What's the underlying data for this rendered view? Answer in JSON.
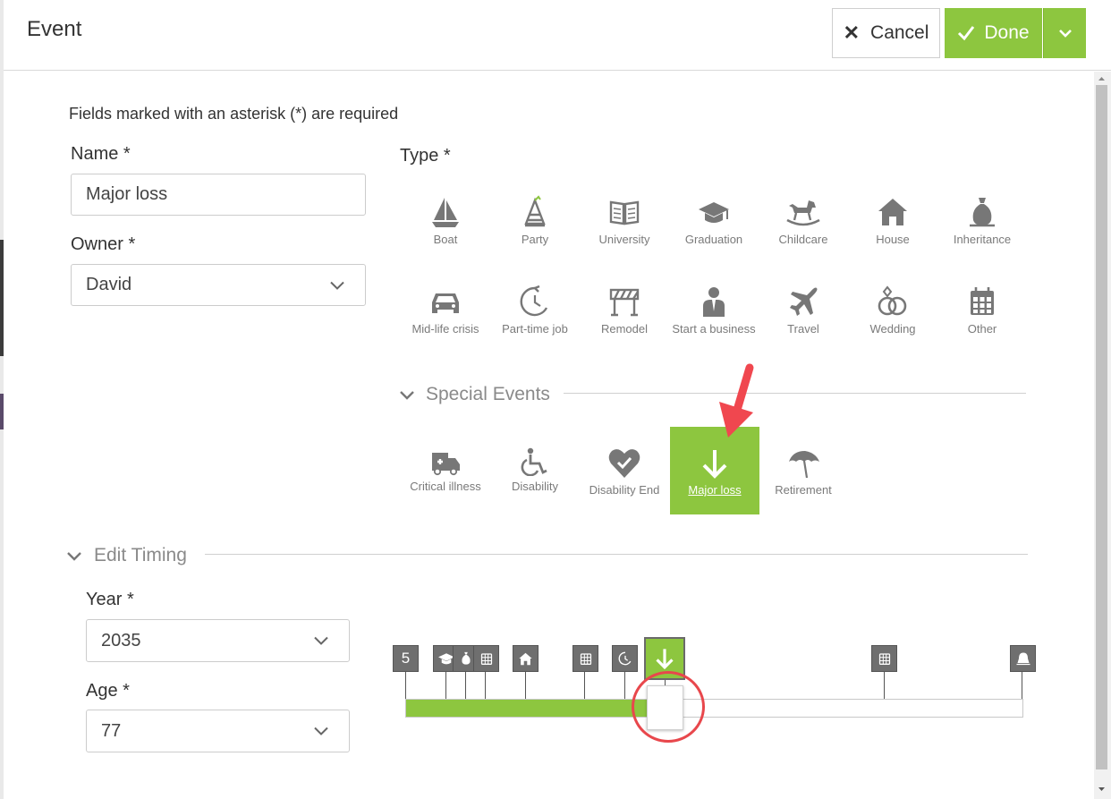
{
  "window": {
    "title": "Event"
  },
  "header": {
    "cancel_label": "Cancel",
    "done_label": "Done"
  },
  "form": {
    "required_note": "Fields marked with an asterisk (*) are required",
    "name_label": "Name *",
    "name_value": "Major loss",
    "owner_label": "Owner *",
    "owner_value": "David",
    "type_label": "Type *"
  },
  "types": [
    {
      "label": "Boat",
      "icon": "boat-icon"
    },
    {
      "label": "Party",
      "icon": "party-hat-icon"
    },
    {
      "label": "University",
      "icon": "book-icon"
    },
    {
      "label": "Graduation",
      "icon": "graduation-cap-icon"
    },
    {
      "label": "Childcare",
      "icon": "rocking-horse-icon"
    },
    {
      "label": "House",
      "icon": "house-icon"
    },
    {
      "label": "Inheritance",
      "icon": "money-bag-icon"
    },
    {
      "label": "Mid-life crisis",
      "icon": "car-icon"
    },
    {
      "label": "Part-time job",
      "icon": "partial-clock-icon"
    },
    {
      "label": "Remodel",
      "icon": "remodel-icon"
    },
    {
      "label": "Start a business",
      "icon": "businessman-icon"
    },
    {
      "label": "Travel",
      "icon": "airplane-icon"
    },
    {
      "label": "Wedding",
      "icon": "rings-icon"
    },
    {
      "label": "Other",
      "icon": "calendar-grid-icon"
    }
  ],
  "special_events": {
    "title": "Special Events",
    "items": [
      {
        "label": "Critical illness",
        "icon": "ambulance-icon"
      },
      {
        "label": "Disability",
        "icon": "wheelchair-icon"
      },
      {
        "label": "Disability End",
        "icon": "heart-check-icon"
      },
      {
        "label": "Major loss",
        "icon": "arrow-down-icon",
        "selected": true
      },
      {
        "label": "Retirement",
        "icon": "umbrella-icon"
      }
    ]
  },
  "timing": {
    "title": "Edit Timing",
    "year_label": "Year *",
    "year_value": "2035",
    "age_label": "Age *",
    "age_value": "77",
    "first_marker_text": "5",
    "progress": 0.39
  },
  "colors": {
    "accent": "#8dc63f",
    "marker": "#6f6f6f",
    "highlight_ring": "#e8474c",
    "annotation_arrow": "#f0474f"
  }
}
